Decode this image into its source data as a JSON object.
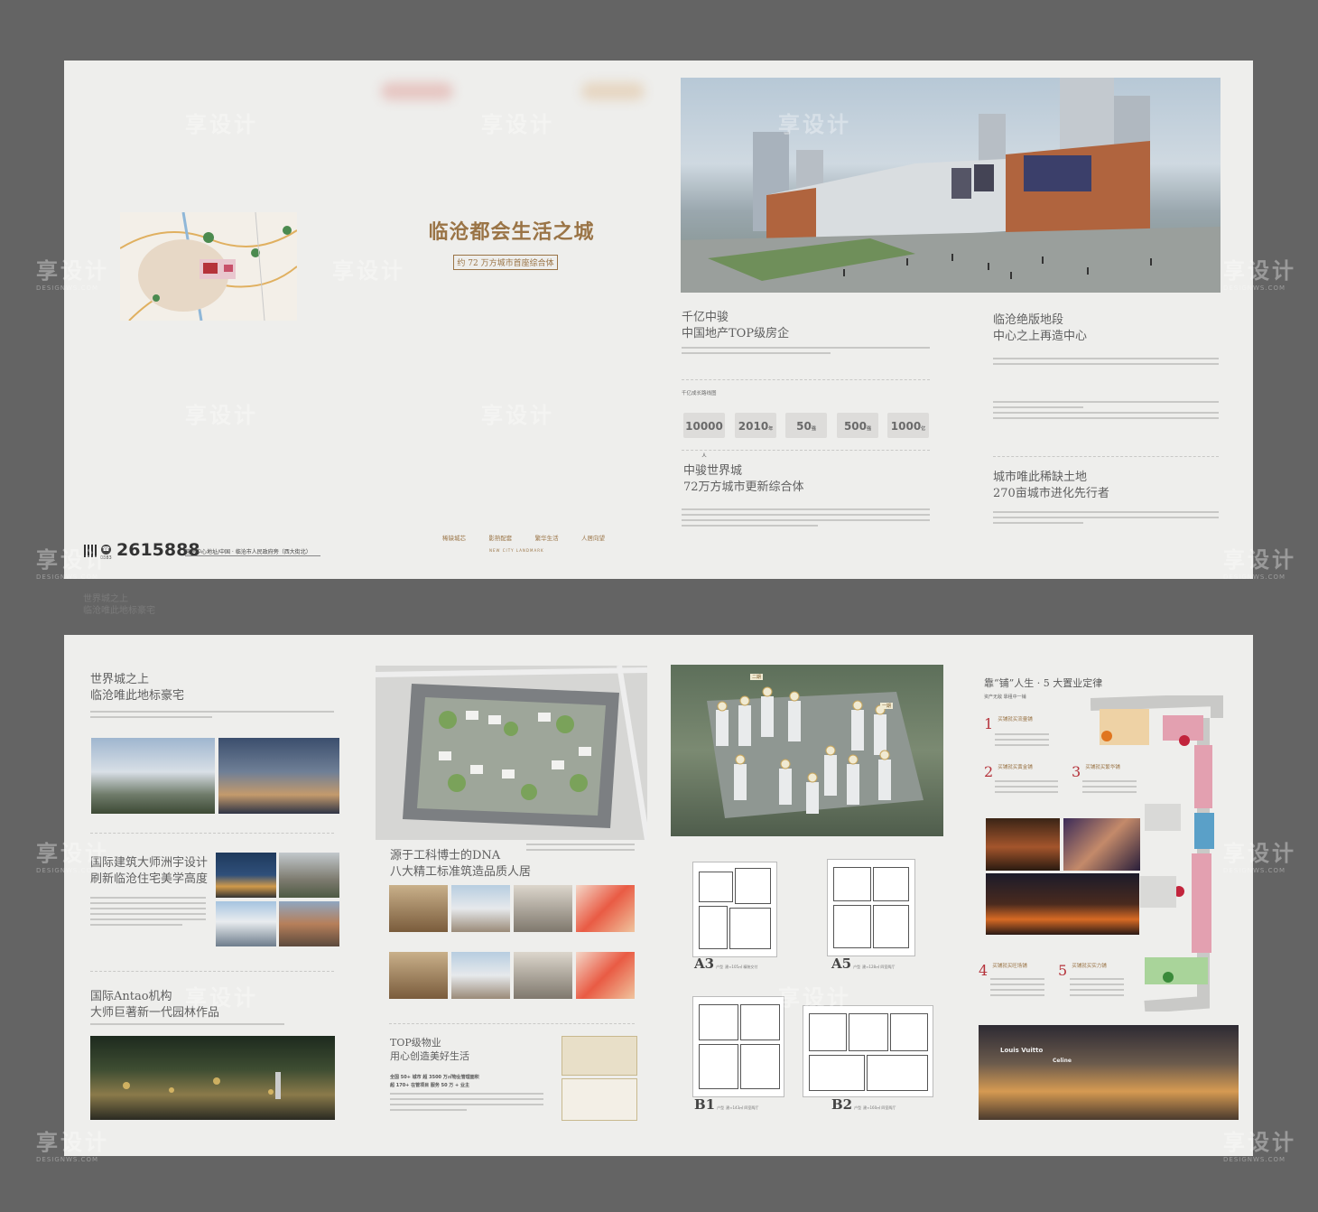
{
  "top_row": {
    "cover_left": {
      "phone_prefix": "0883",
      "phone": "2615888",
      "address": "营销中心地址/中国 · 临沧市人民政府旁（西大街北）"
    },
    "cover_right": {
      "title": "临沧都会生活之城",
      "subtitle": "约 72 万方城市首座综合体",
      "tags": [
        "稀缺城芯",
        "影熟配套",
        "繁华生活",
        "人居向望"
      ],
      "tagline": "NEW CITY LANDMARK"
    },
    "spread": {
      "sec1_title_1": "千亿中骏",
      "sec1_title_2": "中国地产TOP级房企",
      "growth_heading": "千亿成长路线图",
      "stats": [
        {
          "value": "10000",
          "unit": "人"
        },
        {
          "value": "2010",
          "unit": "年"
        },
        {
          "value": "50",
          "unit": "强"
        },
        {
          "value": "500",
          "unit": "强"
        },
        {
          "value": "1000",
          "unit": "亿"
        }
      ],
      "sec2_title_1": "中骏世界城",
      "sec2_title_2": "72万方城市更新综合体",
      "sec3_title_1": "临沧绝版地段",
      "sec3_title_2": "中心之上再造中心",
      "sec4_title_1": "城市唯此稀缺土地",
      "sec4_title_2": "270亩城市进化先行者"
    },
    "ghost_text_1": "世界城之上",
    "ghost_text_2": "临沧唯此地标豪宅"
  },
  "bottom_row": {
    "p1": {
      "t1_1": "世界城之上",
      "t1_2": "临沧唯此地标豪宅",
      "t2_1": "国际建筑大师洲宇设计",
      "t2_2": "刷新临沧住宅美学高度",
      "t3_1": "国际Antao机构",
      "t3_2": "大师巨著新一代园林作品"
    },
    "p2": {
      "t1_1": "源于工科博士的DNA",
      "t1_2": "八大精工标准筑造品质人居",
      "t2_1": "TOP级物业",
      "t2_2": "用心创造美好生活",
      "stats_1": "全国 50+ 城市   超 3500 万㎡物业管理面积",
      "stats_2": "超 170+ 在管项目   服务 50 万 + 业主"
    },
    "p3": {
      "zone_1": "二期",
      "zone_2": "一期",
      "plans": [
        {
          "name": "A3",
          "type": "户型",
          "desc": "建≈105㎡ 精装交付"
        },
        {
          "name": "A5",
          "type": "户型",
          "desc": "建≈128㎡ 四室两厅"
        },
        {
          "name": "B1",
          "type": "户型",
          "desc": "建≈143㎡ 四室两厅"
        },
        {
          "name": "B2",
          "type": "户型",
          "desc": "建≈160㎡ 四室两厅"
        }
      ]
    },
    "p4": {
      "title": "靠“铺”人生 · 5 大置业定律",
      "subtitle": "资产无敌  靠租中一铺",
      "laws": [
        {
          "num": "1",
          "text": "买铺就买流量铺"
        },
        {
          "num": "2",
          "text": "买铺就买黄金铺"
        },
        {
          "num": "3",
          "text": "买铺就买繁华铺"
        },
        {
          "num": "4",
          "text": "买铺就买旺场铺"
        },
        {
          "num": "5",
          "text": "买铺就买实力铺"
        }
      ],
      "store_1": "Louis Vuitto",
      "store_2": "Celine"
    }
  },
  "watermark": {
    "cn": "享设计",
    "en": "DESIGNWS.COM"
  },
  "colors": {
    "background": "#646464",
    "paper": "#eeeeec",
    "gold": "#9a7446",
    "red": "#b5323a"
  }
}
